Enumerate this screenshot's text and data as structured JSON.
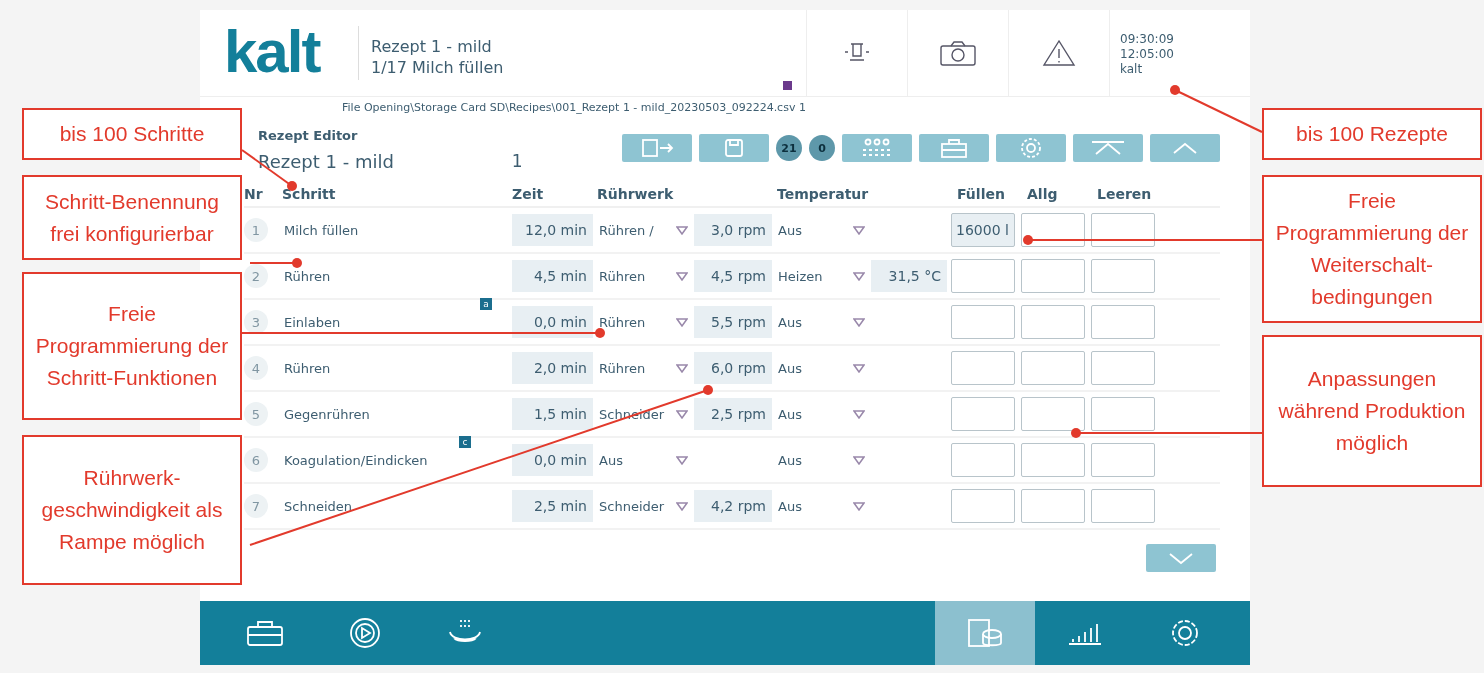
{
  "header": {
    "logo": "kalt",
    "recipe": "Rezept 1 - mild",
    "step": "1/17 Milch füllen",
    "time_1": "09:30:09",
    "time_2": "12:05:00",
    "user": "kalt"
  },
  "file_path": "File Opening\\Storage Card SD\\Recipes\\001_Rezept 1 - mild_20230503_092224.csv 1",
  "editor": {
    "title": "Rezept Editor",
    "recipe_name": "Rezept 1 - mild",
    "recipe_number": "1",
    "counters": [
      "21",
      "0"
    ]
  },
  "table": {
    "columns": [
      "Nr",
      "Schritt",
      "Zeit",
      "Rührwerk",
      "Temperatur",
      "Füllen",
      "Allg",
      "Leeren"
    ],
    "rows": [
      {
        "nr": "1",
        "name": "Milch füllen",
        "zeit": "12,0 min",
        "ruehrwerk": "Rühren /",
        "rpm": "3,0 rpm",
        "temperatur": "Aus",
        "fuellen": "16000 l"
      },
      {
        "nr": "2",
        "name": "Rühren",
        "zeit": "4,5 min",
        "ruehrwerk": "Rühren",
        "rpm": "4,5 rpm",
        "temperatur": "Heizen",
        "temp_value": "31,5 °C"
      },
      {
        "nr": "3",
        "name": "Einlaben",
        "zeit": "0,0 min",
        "ruehrwerk": "Rühren",
        "rpm": "5,5 rpm",
        "temperatur": "Aus",
        "marker": "a"
      },
      {
        "nr": "4",
        "name": "Rühren",
        "zeit": "2,0 min",
        "ruehrwerk": "Rühren",
        "rpm": "6,0 rpm",
        "temperatur": "Aus"
      },
      {
        "nr": "5",
        "name": "Gegenrühren",
        "zeit": "1,5 min",
        "ruehrwerk": "Schneider",
        "rpm": "2,5 rpm",
        "temperatur": "Aus"
      },
      {
        "nr": "6",
        "name": "Koagulation/Eindicken",
        "zeit": "0,0 min",
        "ruehrwerk": "Aus",
        "temperatur": "Aus",
        "marker": "c"
      },
      {
        "nr": "7",
        "name": "Schneiden",
        "zeit": "2,5 min",
        "ruehrwerk": "Schneider",
        "rpm": "4,2 rpm",
        "temperatur": "Aus"
      }
    ]
  },
  "nav": [
    {
      "kind": "toolbox",
      "selected": false
    },
    {
      "kind": "play",
      "selected": false
    },
    {
      "kind": "vat",
      "selected": false
    },
    {
      "kind": "recipes",
      "selected": true
    },
    {
      "kind": "chart",
      "selected": false
    },
    {
      "kind": "settings",
      "selected": false
    }
  ],
  "annotations": [
    {
      "text": "bis 100 Schritte"
    },
    {
      "text": "Schritt-Benennung frei konfigurierbar"
    },
    {
      "text": "Freie Programmierung der Schritt-Funktionen"
    },
    {
      "text": "Rührwerk-geschwindigkeit als Rampe möglich"
    },
    {
      "text": "bis 100 Rezepte"
    },
    {
      "text": "Freie Programmierung der Weiterschalt-bedingungen"
    },
    {
      "text": "Anpassungen während Produktion möglich"
    }
  ]
}
